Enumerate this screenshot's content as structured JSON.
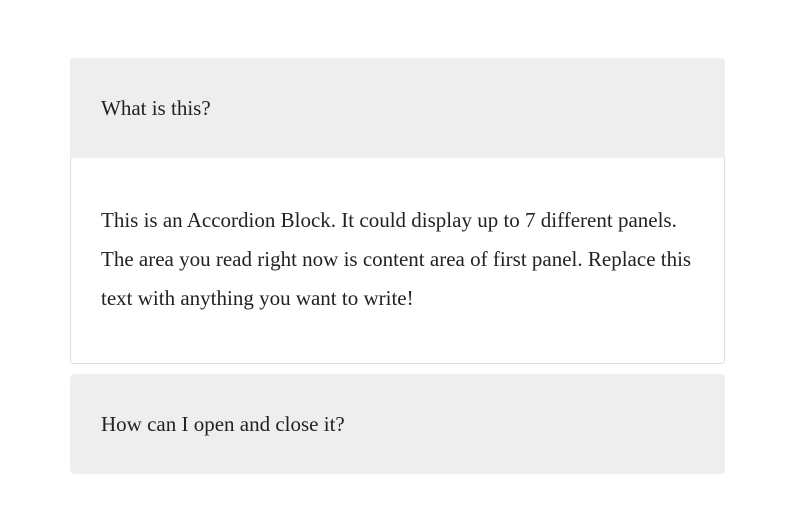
{
  "accordion": {
    "panels": [
      {
        "title": "What is this?",
        "content": "This is an Accordion Block. It could display up to 7 different panels. The area you read right now is content area of first panel. Replace this text with anything you want to write!",
        "expanded": true
      },
      {
        "title": "How can I open and close it?",
        "expanded": false
      }
    ]
  }
}
